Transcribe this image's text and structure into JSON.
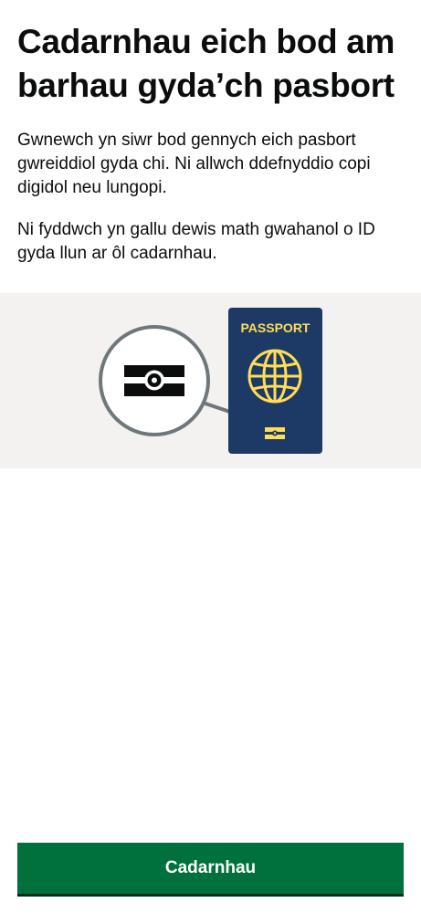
{
  "page": {
    "title": "Cadarnhau eich bod am barhau gyda’ch pasbort",
    "paragraphs": [
      "Gwnewch yn siwr bod gennych eich pasbort gwreiddiol gyda chi. Ni allwch ddefnyddio copi digidol neu lungopi.",
      "Ni fyddwch yn gallu dewis math gwahanol o ID gyda llun ar ôl cadarnhau."
    ]
  },
  "illustration": {
    "passport_label": "PASSPORT",
    "icons": [
      "magnifier-icon",
      "passport-icon",
      "globe-icon",
      "chip-icon"
    ],
    "colors": {
      "background": "#f3f2f1",
      "passport_cover": "#1d3966",
      "passport_accent": "#ffdd57",
      "magnifier_ring": "#6f777b",
      "chip_dark": "#0b0c0c"
    }
  },
  "actions": {
    "confirm_label": "Cadarnhau"
  },
  "theme": {
    "button_green": "#00703c",
    "text": "#0b0c0c"
  }
}
